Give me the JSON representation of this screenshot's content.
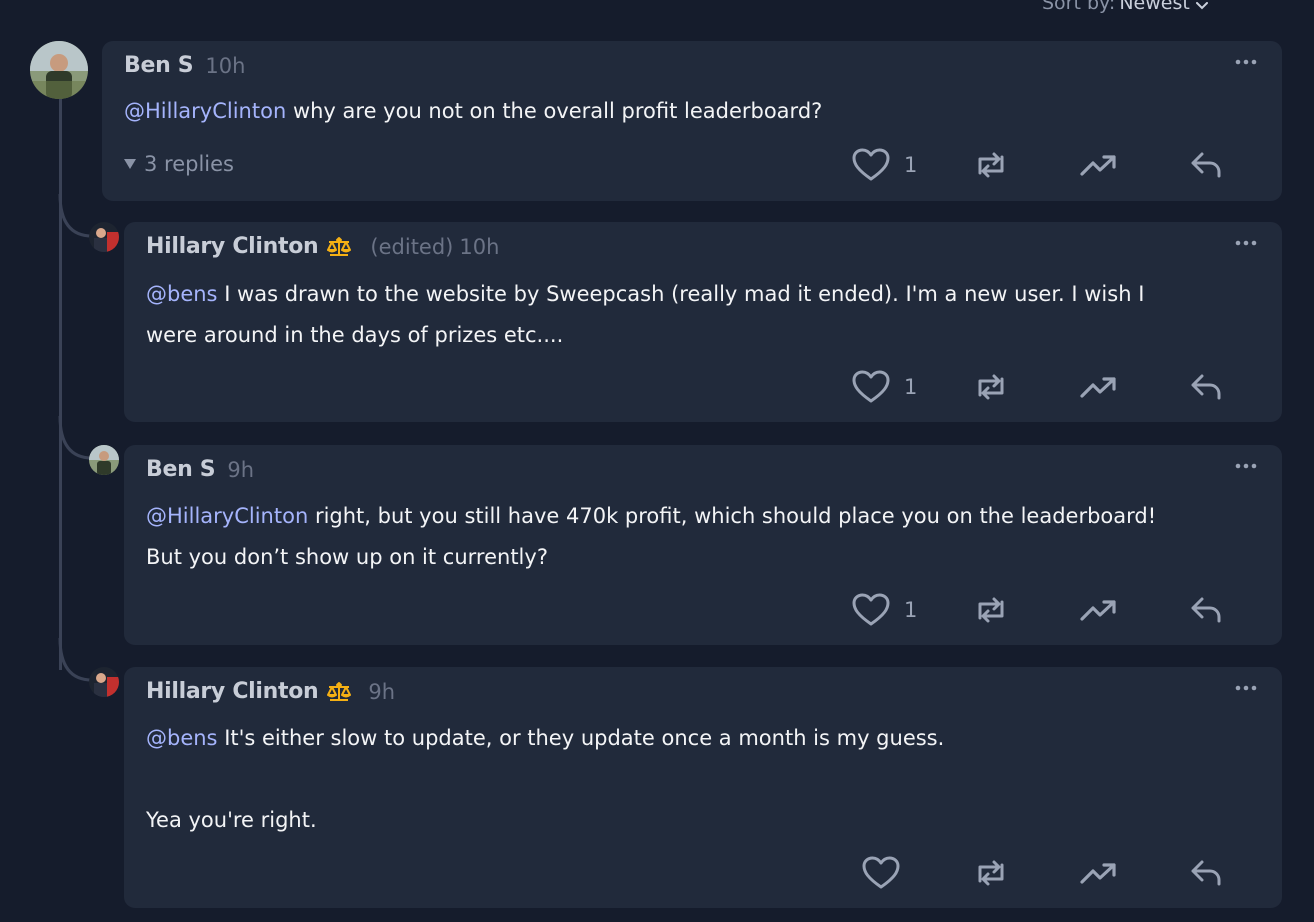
{
  "sort": {
    "label": "Sort by:",
    "value": "Newest"
  },
  "comments": [
    {
      "author": "Ben S",
      "badge": "",
      "edited": "",
      "time": "10h",
      "mention": "@HillaryClinton",
      "lines": [
        " why are you not on the overall profit leaderboard?"
      ],
      "likes": "1",
      "replies_label": "3 replies"
    },
    {
      "author": "Hillary Clinton",
      "badge": "scales-icon",
      "edited": "(edited)",
      "time": "10h",
      "mention": "@bens",
      "lines": [
        " I was drawn to the website by Sweepcash (really mad it ended). I'm a new user. I wish I",
        "were around in the days of prizes etc...."
      ],
      "likes": "1"
    },
    {
      "author": "Ben S",
      "badge": "",
      "edited": "",
      "time": "9h",
      "mention": "@HillaryClinton",
      "lines": [
        " right, but you still have 470k profit, which should place you on the leaderboard!",
        "But you don’t show up on it currently?"
      ],
      "likes": "1"
    },
    {
      "author": "Hillary Clinton",
      "badge": "scales-icon",
      "edited": "",
      "time": "9h",
      "mention": "@bens",
      "lines": [
        " It's either slow to update, or they update once a month is my guess.",
        "",
        "Yea you're right."
      ],
      "likes": ""
    }
  ],
  "colors": {
    "background": "#151c2c",
    "card": "#212a3b",
    "mention": "#a5b4fc",
    "badge": "#f5b014"
  }
}
